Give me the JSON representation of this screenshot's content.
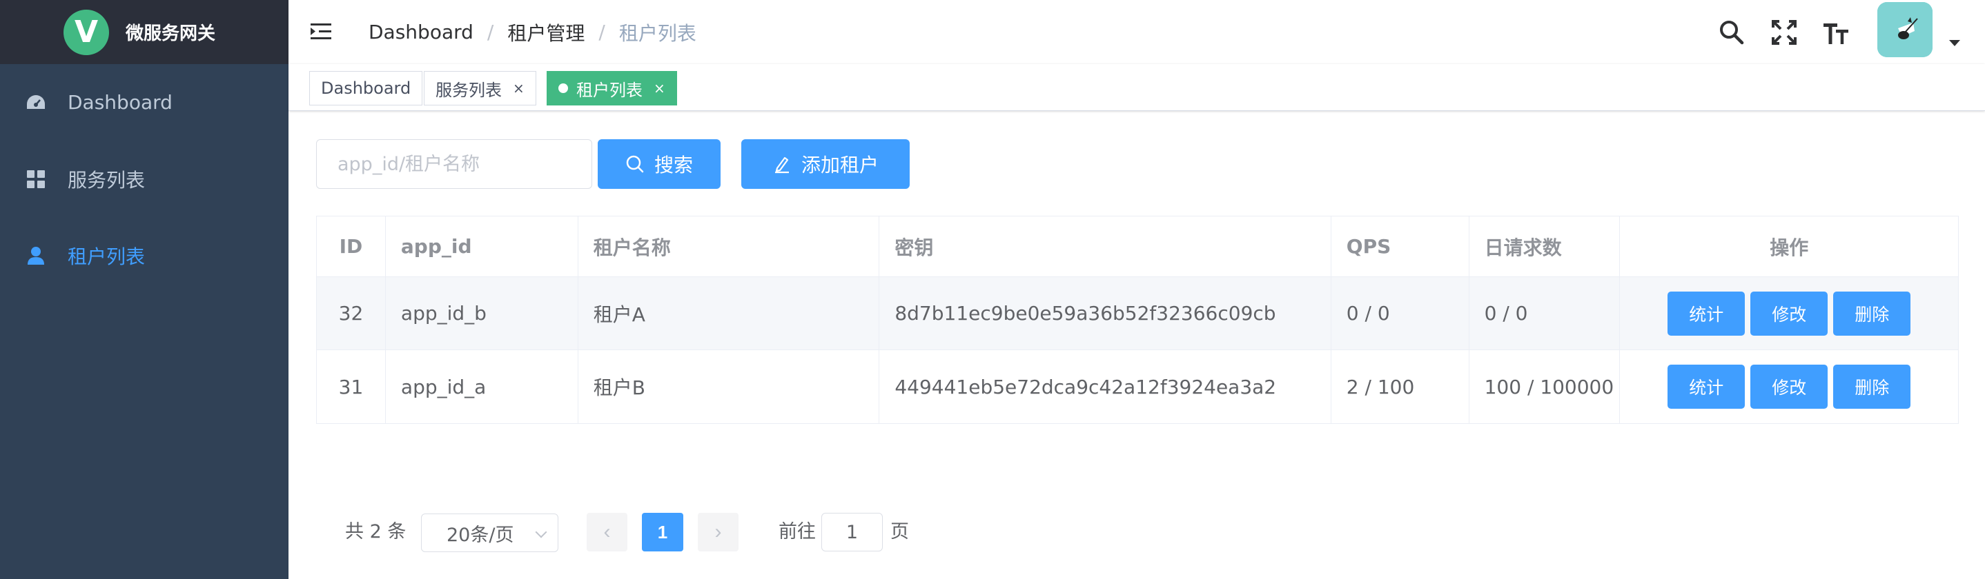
{
  "app": {
    "title": "微服务网关",
    "logo_letter": "V"
  },
  "sidebar": {
    "items": [
      {
        "label": "Dashboard",
        "icon": "dashboard-icon",
        "active": false
      },
      {
        "label": "服务列表",
        "icon": "grid-icon",
        "active": false
      },
      {
        "label": "租户列表",
        "icon": "user-icon",
        "active": true
      }
    ]
  },
  "breadcrumb": [
    "Dashboard",
    "租户管理",
    "租户列表"
  ],
  "breadcrumb_separator": "/",
  "navbar": {
    "icons": [
      "search-icon",
      "fullscreen-icon",
      "font-size-icon"
    ]
  },
  "tags": [
    {
      "label": "Dashboard",
      "active": false,
      "closable": false
    },
    {
      "label": "服务列表",
      "active": false,
      "closable": true
    },
    {
      "label": "租户列表",
      "active": true,
      "closable": true
    }
  ],
  "tag_close": "×",
  "filter": {
    "search_placeholder": "app_id/租户名称",
    "search_button": "搜索",
    "add_button": "添加租户"
  },
  "table": {
    "columns": [
      "ID",
      "app_id",
      "租户名称",
      "密钥",
      "QPS",
      "日请求数",
      "操作"
    ],
    "rows": [
      {
        "id": "32",
        "app_id": "app_id_b",
        "name": "租户A",
        "secret": "8d7b11ec9be0e59a36b52f32366c09cb",
        "qps": "0 / 0",
        "daily": "0 / 0"
      },
      {
        "id": "31",
        "app_id": "app_id_a",
        "name": "租户B",
        "secret": "449441eb5e72dca9c42a12f3924ea3a2",
        "qps": "2 / 100",
        "daily": "100 / 100000"
      }
    ],
    "actions": [
      "统计",
      "修改",
      "删除"
    ]
  },
  "pagination": {
    "total": "共 2 条",
    "page_size": "20条/页",
    "current_page": "1",
    "prev": "‹",
    "next": "›",
    "jump_prefix": "前往",
    "jump_value": "1",
    "jump_suffix": "页"
  },
  "colors": {
    "sidebar_bg": "#304156",
    "logo_bar_bg": "#2b2f3a",
    "primary": "#409eff",
    "active_tag": "#42b983"
  }
}
